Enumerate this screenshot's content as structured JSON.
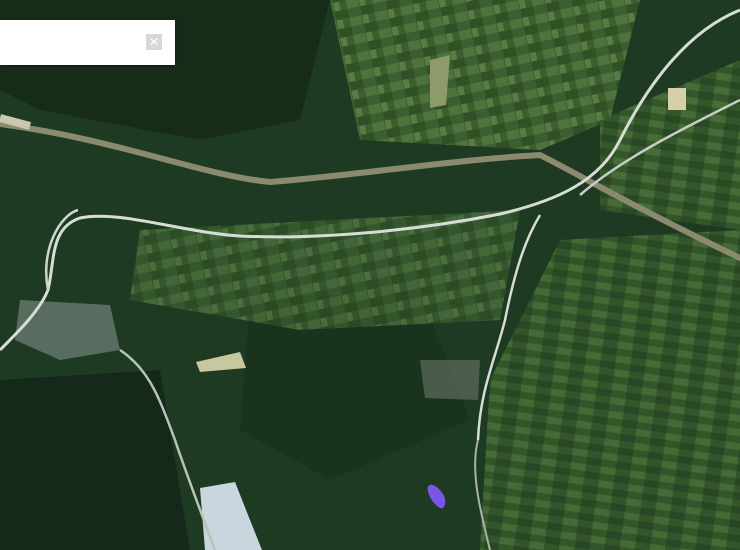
{
  "map": {
    "view": "satellite",
    "colors": {
      "forest": "#1f3a22",
      "forest_dark": "#162c19",
      "field": "#4c6f3c",
      "field_light": "#6f8d53",
      "road": "#d6ddd6",
      "old_road": "#8c8a6e",
      "built": "#c9d6de",
      "marker": "#7a55e8"
    }
  },
  "search": {
    "value": "",
    "placeholder": "",
    "clear_icon": "close-icon",
    "clear_glyph": "✕"
  }
}
